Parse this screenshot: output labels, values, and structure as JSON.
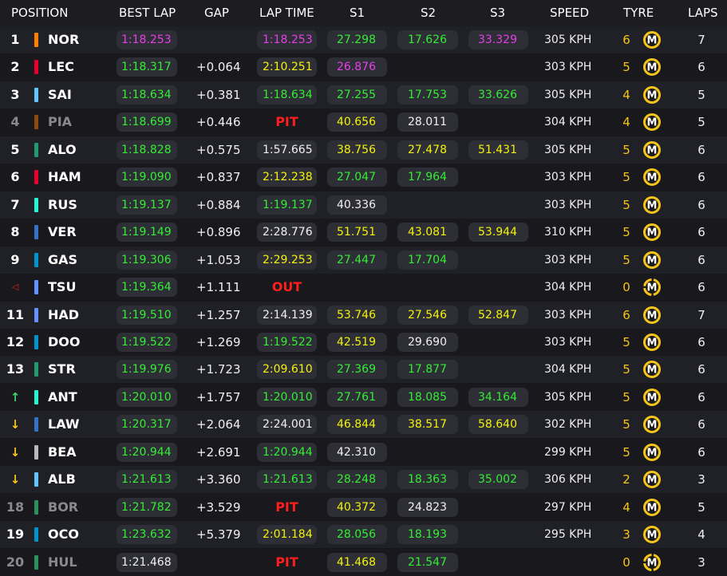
{
  "headers": {
    "position": "POSITION",
    "best_lap": "BEST LAP",
    "gap": "GAP",
    "lap_time": "LAP TIME",
    "s1": "S1",
    "s2": "S2",
    "s3": "S3",
    "speed": "SPEED",
    "tyre": "TYRE",
    "laps": "LAPS"
  },
  "colors": {
    "personal_best": "#33ee33",
    "session_best": "#e540e5",
    "slower": "#f2f20a",
    "neutral": "#f0f0f0",
    "pit_out": "#ff1e1e",
    "tyre_medium": "#f5c518"
  },
  "rows": [
    {
      "pos": "1",
      "pos_style": "normal",
      "team_color": "#ff8000",
      "driver": "NOR",
      "dim": false,
      "best_lap": "1:18.253",
      "best_lap_color": "purple",
      "gap": "",
      "lap_time": "1:18.253",
      "lap_time_color": "purple",
      "status": "",
      "s1": "27.298",
      "s1_color": "green",
      "s2": "17.626",
      "s2_color": "green",
      "s3": "33.329",
      "s3_color": "purple",
      "speed": "305 KPH",
      "tyre_age": "6",
      "tyre": "M",
      "tyre_new": false,
      "laps": "7"
    },
    {
      "pos": "2",
      "pos_style": "normal",
      "team_color": "#e8002d",
      "driver": "LEC",
      "dim": false,
      "best_lap": "1:18.317",
      "best_lap_color": "green",
      "gap": "+0.064",
      "lap_time": "2:10.251",
      "lap_time_color": "yellow",
      "status": "",
      "s1": "26.876",
      "s1_color": "purple",
      "s2": "",
      "s2_color": "",
      "s3": "",
      "s3_color": "",
      "speed": "303 KPH",
      "tyre_age": "5",
      "tyre": "M",
      "tyre_new": false,
      "laps": "6"
    },
    {
      "pos": "3",
      "pos_style": "normal",
      "team_color": "#64c4ff",
      "driver": "SAI",
      "dim": false,
      "best_lap": "1:18.634",
      "best_lap_color": "green",
      "gap": "+0.381",
      "lap_time": "1:18.634",
      "lap_time_color": "green",
      "status": "",
      "s1": "27.255",
      "s1_color": "green",
      "s2": "17.753",
      "s2_color": "green",
      "s3": "33.626",
      "s3_color": "green",
      "speed": "305 KPH",
      "tyre_age": "4",
      "tyre": "M",
      "tyre_new": false,
      "laps": "5"
    },
    {
      "pos": "4",
      "pos_style": "dim",
      "team_color": "#8a4b10",
      "driver": "PIA",
      "dim": true,
      "best_lap": "1:18.699",
      "best_lap_color": "green",
      "gap": "+0.446",
      "lap_time": "",
      "lap_time_color": "",
      "status": "PIT",
      "s1": "40.656",
      "s1_color": "yellow",
      "s2": "28.011",
      "s2_color": "white",
      "s3": "",
      "s3_color": "",
      "speed": "304 KPH",
      "tyre_age": "4",
      "tyre": "M",
      "tyre_new": false,
      "laps": "5"
    },
    {
      "pos": "5",
      "pos_style": "normal",
      "team_color": "#229971",
      "driver": "ALO",
      "dim": false,
      "best_lap": "1:18.828",
      "best_lap_color": "green",
      "gap": "+0.575",
      "lap_time": "1:57.665",
      "lap_time_color": "white",
      "status": "",
      "s1": "38.756",
      "s1_color": "yellow",
      "s2": "27.478",
      "s2_color": "yellow",
      "s3": "51.431",
      "s3_color": "yellow",
      "speed": "305 KPH",
      "tyre_age": "5",
      "tyre": "M",
      "tyre_new": false,
      "laps": "6"
    },
    {
      "pos": "6",
      "pos_style": "normal",
      "team_color": "#e8002d",
      "driver": "HAM",
      "dim": false,
      "best_lap": "1:19.090",
      "best_lap_color": "green",
      "gap": "+0.837",
      "lap_time": "2:12.238",
      "lap_time_color": "yellow",
      "status": "",
      "s1": "27.047",
      "s1_color": "green",
      "s2": "17.964",
      "s2_color": "green",
      "s3": "",
      "s3_color": "",
      "speed": "303 KPH",
      "tyre_age": "5",
      "tyre": "M",
      "tyre_new": false,
      "laps": "6"
    },
    {
      "pos": "7",
      "pos_style": "normal",
      "team_color": "#27f4d2",
      "driver": "RUS",
      "dim": false,
      "best_lap": "1:19.137",
      "best_lap_color": "green",
      "gap": "+0.884",
      "lap_time": "1:19.137",
      "lap_time_color": "green",
      "status": "",
      "s1": "40.336",
      "s1_color": "white",
      "s2": "",
      "s2_color": "",
      "s3": "",
      "s3_color": "",
      "speed": "303 KPH",
      "tyre_age": "5",
      "tyre": "M",
      "tyre_new": false,
      "laps": "6"
    },
    {
      "pos": "8",
      "pos_style": "normal",
      "team_color": "#3671c6",
      "driver": "VER",
      "dim": false,
      "best_lap": "1:19.149",
      "best_lap_color": "green",
      "gap": "+0.896",
      "lap_time": "2:28.776",
      "lap_time_color": "white",
      "status": "",
      "s1": "51.751",
      "s1_color": "yellow",
      "s2": "43.081",
      "s2_color": "yellow",
      "s3": "53.944",
      "s3_color": "yellow",
      "speed": "310 KPH",
      "tyre_age": "5",
      "tyre": "M",
      "tyre_new": false,
      "laps": "6"
    },
    {
      "pos": "9",
      "pos_style": "normal",
      "team_color": "#0093cc",
      "driver": "GAS",
      "dim": false,
      "best_lap": "1:19.306",
      "best_lap_color": "green",
      "gap": "+1.053",
      "lap_time": "2:29.253",
      "lap_time_color": "yellow",
      "status": "",
      "s1": "27.447",
      "s1_color": "green",
      "s2": "17.704",
      "s2_color": "green",
      "s3": "",
      "s3_color": "",
      "speed": "303 KPH",
      "tyre_age": "5",
      "tyre": "M",
      "tyre_new": false,
      "laps": "6"
    },
    {
      "pos": "◁",
      "pos_style": "tri",
      "team_color": "#6692ff",
      "driver": "TSU",
      "dim": false,
      "best_lap": "1:19.364",
      "best_lap_color": "green",
      "gap": "+1.111",
      "lap_time": "",
      "lap_time_color": "",
      "status": "OUT",
      "s1": "",
      "s1_color": "",
      "s2": "",
      "s2_color": "",
      "s3": "",
      "s3_color": "",
      "speed": "304 KPH",
      "tyre_age": "0",
      "tyre": "M",
      "tyre_new": true,
      "laps": "6"
    },
    {
      "pos": "11",
      "pos_style": "normal",
      "team_color": "#6692ff",
      "driver": "HAD",
      "dim": false,
      "best_lap": "1:19.510",
      "best_lap_color": "green",
      "gap": "+1.257",
      "lap_time": "2:14.139",
      "lap_time_color": "white",
      "status": "",
      "s1": "53.746",
      "s1_color": "yellow",
      "s2": "27.546",
      "s2_color": "yellow",
      "s3": "52.847",
      "s3_color": "yellow",
      "speed": "303 KPH",
      "tyre_age": "6",
      "tyre": "M",
      "tyre_new": false,
      "laps": "7"
    },
    {
      "pos": "12",
      "pos_style": "normal",
      "team_color": "#0093cc",
      "driver": "DOO",
      "dim": false,
      "best_lap": "1:19.522",
      "best_lap_color": "green",
      "gap": "+1.269",
      "lap_time": "1:19.522",
      "lap_time_color": "green",
      "status": "",
      "s1": "42.519",
      "s1_color": "yellow",
      "s2": "29.690",
      "s2_color": "white",
      "s3": "",
      "s3_color": "",
      "speed": "303 KPH",
      "tyre_age": "5",
      "tyre": "M",
      "tyre_new": false,
      "laps": "6"
    },
    {
      "pos": "13",
      "pos_style": "normal",
      "team_color": "#229971",
      "driver": "STR",
      "dim": false,
      "best_lap": "1:19.976",
      "best_lap_color": "green",
      "gap": "+1.723",
      "lap_time": "2:09.610",
      "lap_time_color": "yellow",
      "status": "",
      "s1": "27.369",
      "s1_color": "green",
      "s2": "17.877",
      "s2_color": "green",
      "s3": "",
      "s3_color": "",
      "speed": "304 KPH",
      "tyre_age": "5",
      "tyre": "M",
      "tyre_new": false,
      "laps": "6"
    },
    {
      "pos": "↑",
      "pos_style": "up",
      "team_color": "#27f4d2",
      "driver": "ANT",
      "dim": false,
      "best_lap": "1:20.010",
      "best_lap_color": "green",
      "gap": "+1.757",
      "lap_time": "1:20.010",
      "lap_time_color": "green",
      "status": "",
      "s1": "27.761",
      "s1_color": "green",
      "s2": "18.085",
      "s2_color": "green",
      "s3": "34.164",
      "s3_color": "green",
      "speed": "305 KPH",
      "tyre_age": "5",
      "tyre": "M",
      "tyre_new": false,
      "laps": "6"
    },
    {
      "pos": "↓",
      "pos_style": "down",
      "team_color": "#3671c6",
      "driver": "LAW",
      "dim": false,
      "best_lap": "1:20.317",
      "best_lap_color": "green",
      "gap": "+2.064",
      "lap_time": "2:24.001",
      "lap_time_color": "white",
      "status": "",
      "s1": "46.844",
      "s1_color": "yellow",
      "s2": "38.517",
      "s2_color": "yellow",
      "s3": "58.640",
      "s3_color": "yellow",
      "speed": "302 KPH",
      "tyre_age": "5",
      "tyre": "M",
      "tyre_new": false,
      "laps": "6"
    },
    {
      "pos": "↓",
      "pos_style": "down",
      "team_color": "#b6babd",
      "driver": "BEA",
      "dim": false,
      "best_lap": "1:20.944",
      "best_lap_color": "green",
      "gap": "+2.691",
      "lap_time": "1:20.944",
      "lap_time_color": "green",
      "status": "",
      "s1": "42.310",
      "s1_color": "white",
      "s2": "",
      "s2_color": "",
      "s3": "",
      "s3_color": "",
      "speed": "299 KPH",
      "tyre_age": "5",
      "tyre": "M",
      "tyre_new": false,
      "laps": "6"
    },
    {
      "pos": "↓",
      "pos_style": "down",
      "team_color": "#64c4ff",
      "driver": "ALB",
      "dim": false,
      "best_lap": "1:21.613",
      "best_lap_color": "green",
      "gap": "+3.360",
      "lap_time": "1:21.613",
      "lap_time_color": "green",
      "status": "",
      "s1": "28.248",
      "s1_color": "green",
      "s2": "18.363",
      "s2_color": "green",
      "s3": "35.002",
      "s3_color": "green",
      "speed": "306 KPH",
      "tyre_age": "2",
      "tyre": "M",
      "tyre_new": false,
      "laps": "3"
    },
    {
      "pos": "18",
      "pos_style": "dim",
      "team_color": "#2c8f5e",
      "driver": "BOR",
      "dim": true,
      "best_lap": "1:21.782",
      "best_lap_color": "green",
      "gap": "+3.529",
      "lap_time": "",
      "lap_time_color": "",
      "status": "PIT",
      "s1": "40.372",
      "s1_color": "yellow",
      "s2": "24.823",
      "s2_color": "white",
      "s3": "",
      "s3_color": "",
      "speed": "297 KPH",
      "tyre_age": "4",
      "tyre": "M",
      "tyre_new": false,
      "laps": "5"
    },
    {
      "pos": "19",
      "pos_style": "normal",
      "team_color": "#0093cc",
      "driver": "OCO",
      "dim": false,
      "best_lap": "1:23.632",
      "best_lap_color": "green",
      "gap": "+5.379",
      "lap_time": "2:01.184",
      "lap_time_color": "yellow",
      "status": "",
      "s1": "28.056",
      "s1_color": "green",
      "s2": "18.193",
      "s2_color": "green",
      "s3": "",
      "s3_color": "",
      "speed": "295 KPH",
      "tyre_age": "3",
      "tyre": "M",
      "tyre_new": false,
      "laps": "4"
    },
    {
      "pos": "20",
      "pos_style": "dim",
      "team_color": "#2c8f5e",
      "driver": "HUL",
      "dim": true,
      "best_lap": "1:21.468",
      "best_lap_color": "",
      "gap": "",
      "lap_time": "",
      "lap_time_color": "",
      "status": "PIT",
      "s1": "41.468",
      "s1_color": "yellow",
      "s2": "21.547",
      "s2_color": "green",
      "s3": "",
      "s3_color": "",
      "speed": "",
      "tyre_age": "0",
      "tyre": "M",
      "tyre_new": true,
      "laps": "3"
    }
  ]
}
